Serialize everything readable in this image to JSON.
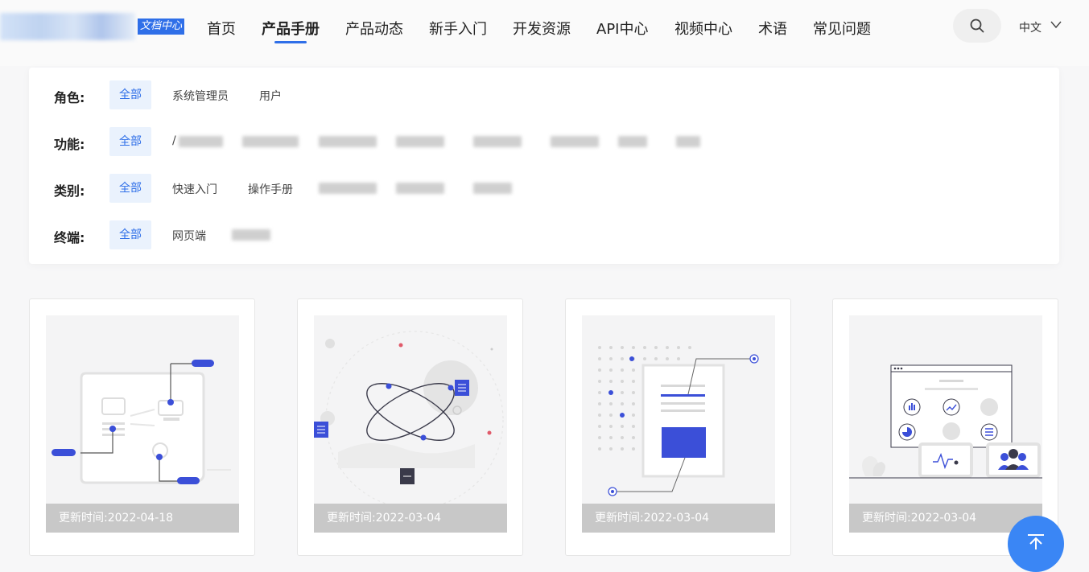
{
  "header": {
    "logo_tag": "文档中心",
    "nav": [
      {
        "label": "首页",
        "active": false
      },
      {
        "label": "产品手册",
        "active": true
      },
      {
        "label": "产品动态",
        "active": false
      },
      {
        "label": "新手入门",
        "active": false
      },
      {
        "label": "开发资源",
        "active": false
      },
      {
        "label": "API中心",
        "active": false
      },
      {
        "label": "视频中心",
        "active": false
      },
      {
        "label": "术语",
        "active": false
      },
      {
        "label": "常见问题",
        "active": false
      }
    ],
    "search_icon": "search-icon",
    "language": "中文",
    "language_caret_icon": "chevron-down-icon"
  },
  "filters": {
    "role": {
      "label": "角色:",
      "selected": "全部",
      "options": [
        "系统管理员",
        "用户"
      ]
    },
    "function": {
      "label": "功能:",
      "selected": "全部",
      "options": [
        "/"
      ]
    },
    "category": {
      "label": "类别:",
      "selected": "全部",
      "options": [
        "快速入门",
        "操作手册"
      ]
    },
    "terminal": {
      "label": "终端:",
      "selected": "全部",
      "options": [
        "网页端"
      ]
    }
  },
  "cards": [
    {
      "date_label": "更新时间:",
      "date": "2022-04-18"
    },
    {
      "date_label": "更新时间:",
      "date": "2022-03-04"
    },
    {
      "date_label": "更新时间:",
      "date": "2022-03-04"
    },
    {
      "date_label": "更新时间:",
      "date": "2022-03-04"
    }
  ],
  "colors": {
    "accent": "#2f6fe8",
    "illustration": "#3b4fd8",
    "chip_bg": "#eaf2fd"
  },
  "back_to_top_icon": "arrow-up-icon"
}
